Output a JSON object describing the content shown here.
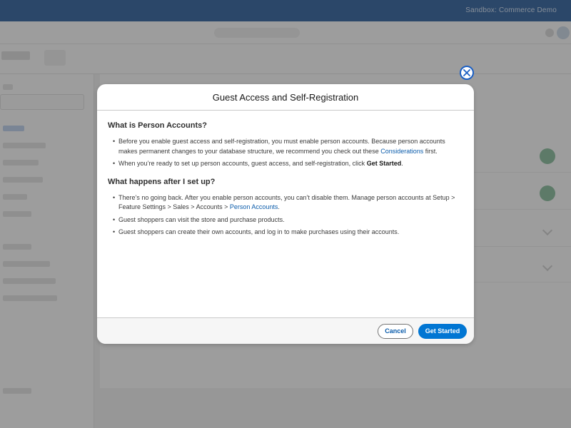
{
  "topbar": {
    "text": "Sandbox: Commerce Demo"
  },
  "modal": {
    "title": "Guest Access and Self-Registration",
    "close_icon": "close-icon",
    "sections": [
      {
        "heading": "What is Person Accounts?",
        "bullets": [
          {
            "text_before": "Before you enable guest access and self-registration, you must enable person accounts. Because person accounts makes permanent changes to your database structure, we recommend you check out these ",
            "link": "Considerations",
            "text_after": " first."
          },
          {
            "text_before": "When you’re ready to set up person accounts, guest access, and self-registration, click ",
            "bold": "Get Started",
            "text_after": "."
          }
        ]
      },
      {
        "heading": "What happens after I set up?",
        "bullets": [
          {
            "text_before": "There’s no going back. After you enable person accounts, you can’t disable them. Manage person accounts at Setup > Feature Settings > Sales > Accounts > ",
            "link": "Person Accounts",
            "text_after": "."
          },
          {
            "text": "Guest shoppers can visit the store and purchase products."
          },
          {
            "text": "Guest shoppers can create their own accounts, and log in to make purchases using their accounts."
          }
        ]
      }
    ],
    "footer": {
      "cancel_label": "Cancel",
      "primary_label": "Get Started"
    }
  },
  "colors": {
    "brand_blue": "#0176d3",
    "link_blue": "#0b5cab",
    "topbar_blue": "#1b5297"
  }
}
